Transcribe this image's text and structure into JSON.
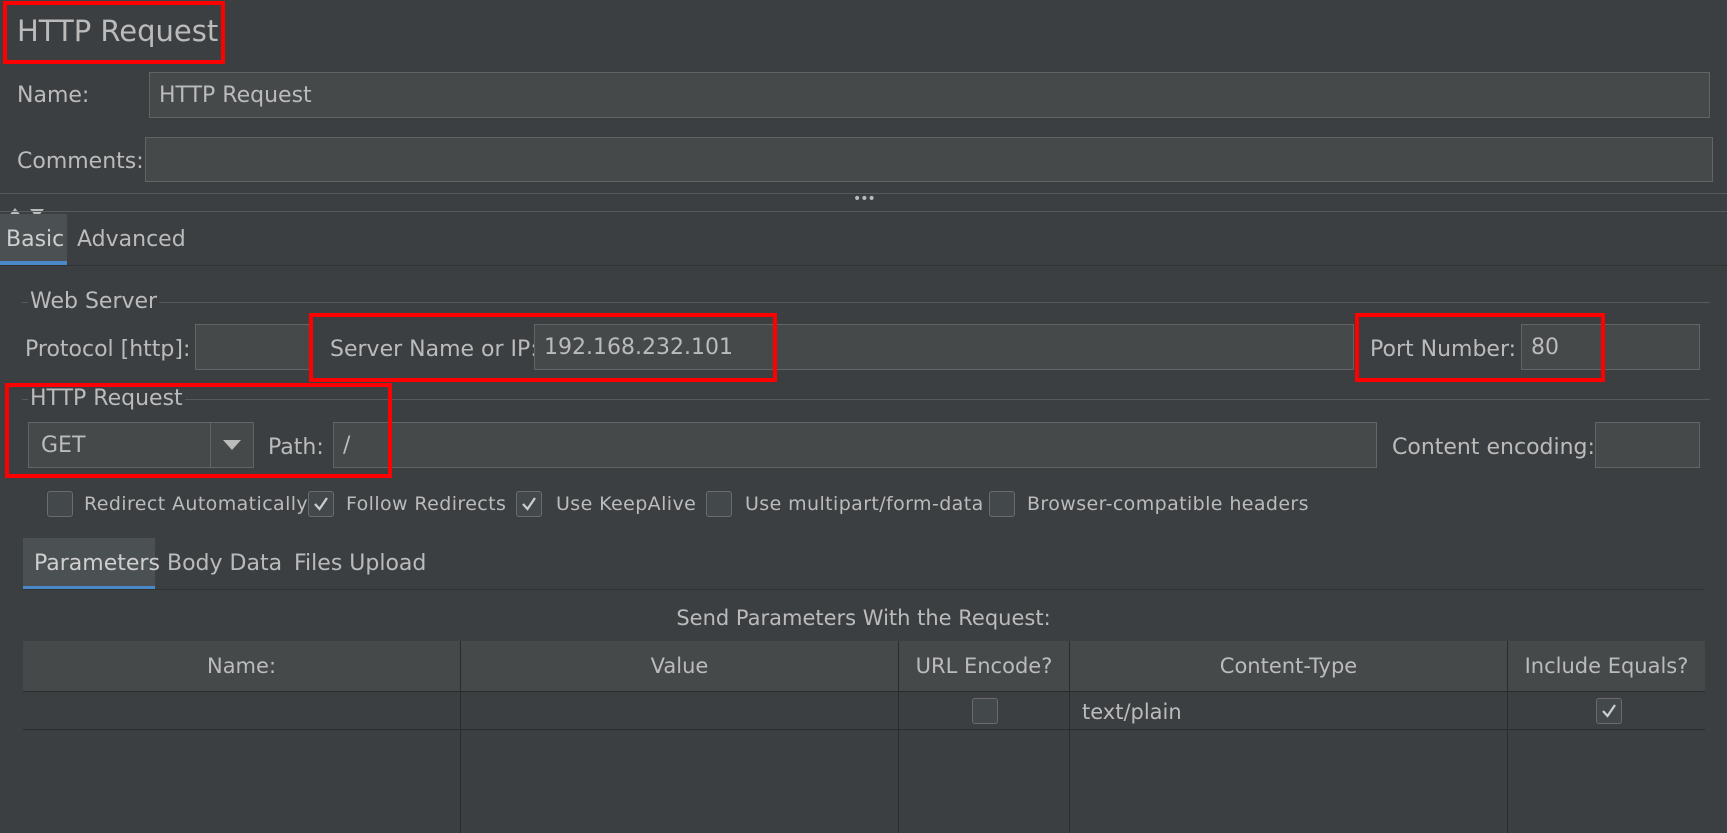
{
  "header": {
    "title": "HTTP Request"
  },
  "name_field": {
    "label": "Name:",
    "value": "HTTP Request"
  },
  "comments_field": {
    "label": "Comments:",
    "value": ""
  },
  "splitter": {
    "dots": "•••"
  },
  "main_tabs": [
    {
      "label": "Basic",
      "selected": true
    },
    {
      "label": "Advanced",
      "selected": false
    }
  ],
  "web_server": {
    "legend": "Web Server",
    "protocol_label": "Protocol [http]:",
    "protocol_value": "",
    "server_label": "Server Name or IP:",
    "server_value": "192.168.232.101",
    "port_label": "Port Number:",
    "port_value": "80"
  },
  "http_request": {
    "legend": "HTTP Request",
    "method": "GET",
    "path_label": "Path:",
    "path_value": "/",
    "encoding_label": "Content encoding:",
    "encoding_value": ""
  },
  "options": [
    {
      "label": "Redirect Automatically",
      "checked": false
    },
    {
      "label": "Follow Redirects",
      "checked": true
    },
    {
      "label": "Use KeepAlive",
      "checked": true
    },
    {
      "label": "Use multipart/form-data",
      "checked": false
    },
    {
      "label": "Browser-compatible headers",
      "checked": false
    }
  ],
  "param_tabs": [
    {
      "label": "Parameters",
      "selected": true
    },
    {
      "label": "Body Data",
      "selected": false
    },
    {
      "label": "Files Upload",
      "selected": false
    }
  ],
  "params": {
    "caption": "Send Parameters With the Request:",
    "columns": [
      "Name:",
      "Value",
      "URL Encode?",
      "Content-Type",
      "Include Equals?"
    ],
    "rows": [
      {
        "name": "",
        "value": "",
        "url_encode": false,
        "content_type": "text/plain",
        "include_equals": true
      }
    ]
  },
  "colors": {
    "background": "#3c3f41",
    "field": "#45494a",
    "accent": "#4a88c7",
    "highlight": "#ff0000"
  }
}
